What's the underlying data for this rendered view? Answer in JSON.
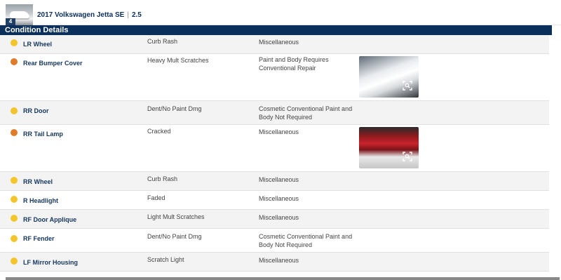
{
  "vehicle": {
    "name": "2017 Volkswagen Jetta SE",
    "separator": "|",
    "engine": "2.5",
    "thumb_tag": "4"
  },
  "section": {
    "title": "Condition Details"
  },
  "severity_colors": {
    "yellow": "#f3c52d",
    "orange": "#e07b2a"
  },
  "rows": [
    {
      "severity": "yellow",
      "area": "LR Wheel",
      "damage": "Curb Rash",
      "action": "Miscellaneous",
      "photo": ""
    },
    {
      "severity": "orange",
      "area": "Rear Bumper Cover",
      "damage": "Heavy Mult Scratches",
      "action": "Paint and Body Requires Conventional Repair",
      "photo": "rear-bumper-photo"
    },
    {
      "severity": "yellow",
      "area": "RR Door",
      "damage": "Dent/No Paint Dmg",
      "action": "Cosmetic Conventional Paint and Body Not Required",
      "photo": ""
    },
    {
      "severity": "orange",
      "area": "RR Tail Lamp",
      "damage": "Cracked",
      "action": "Miscellaneous",
      "photo": "tail-lamp-photo"
    },
    {
      "severity": "yellow",
      "area": "RR Wheel",
      "damage": "Curb Rash",
      "action": "Miscellaneous",
      "photo": ""
    },
    {
      "severity": "yellow",
      "area": "R Headlight",
      "damage": "Faded",
      "action": "Miscellaneous",
      "photo": ""
    },
    {
      "severity": "yellow",
      "area": "RF Door Applique",
      "damage": "Light Mult Scratches",
      "action": "Miscellaneous",
      "photo": ""
    },
    {
      "severity": "yellow",
      "area": "RF Fender",
      "damage": "Dent/No Paint Dmg",
      "action": "Cosmetic Conventional Paint and Body Not Required",
      "photo": ""
    },
    {
      "severity": "yellow",
      "area": "LF Mirror Housing",
      "damage": "Scratch Light",
      "action": "Miscellaneous",
      "photo": ""
    }
  ]
}
